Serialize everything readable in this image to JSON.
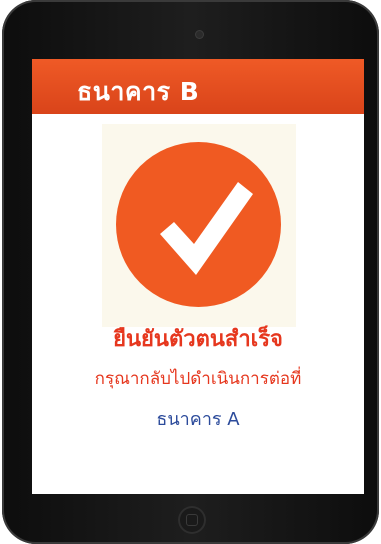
{
  "header": {
    "title": "ธนาคาร B"
  },
  "status": {
    "success_text": "ยืนยันตัวตนสำเร็จ",
    "instruction_text": "กรุณากลับไปดำเนินการต่อที่",
    "destination_bank": "ธนาคาร A"
  },
  "icons": {
    "status_icon": "checkmark-icon",
    "home": "home-button-icon",
    "camera": "front-camera-icon"
  },
  "colors": {
    "header": "#e84f22",
    "accent": "#f05a22",
    "success_text": "#e6371e",
    "bank_link": "#2c4b9b"
  }
}
